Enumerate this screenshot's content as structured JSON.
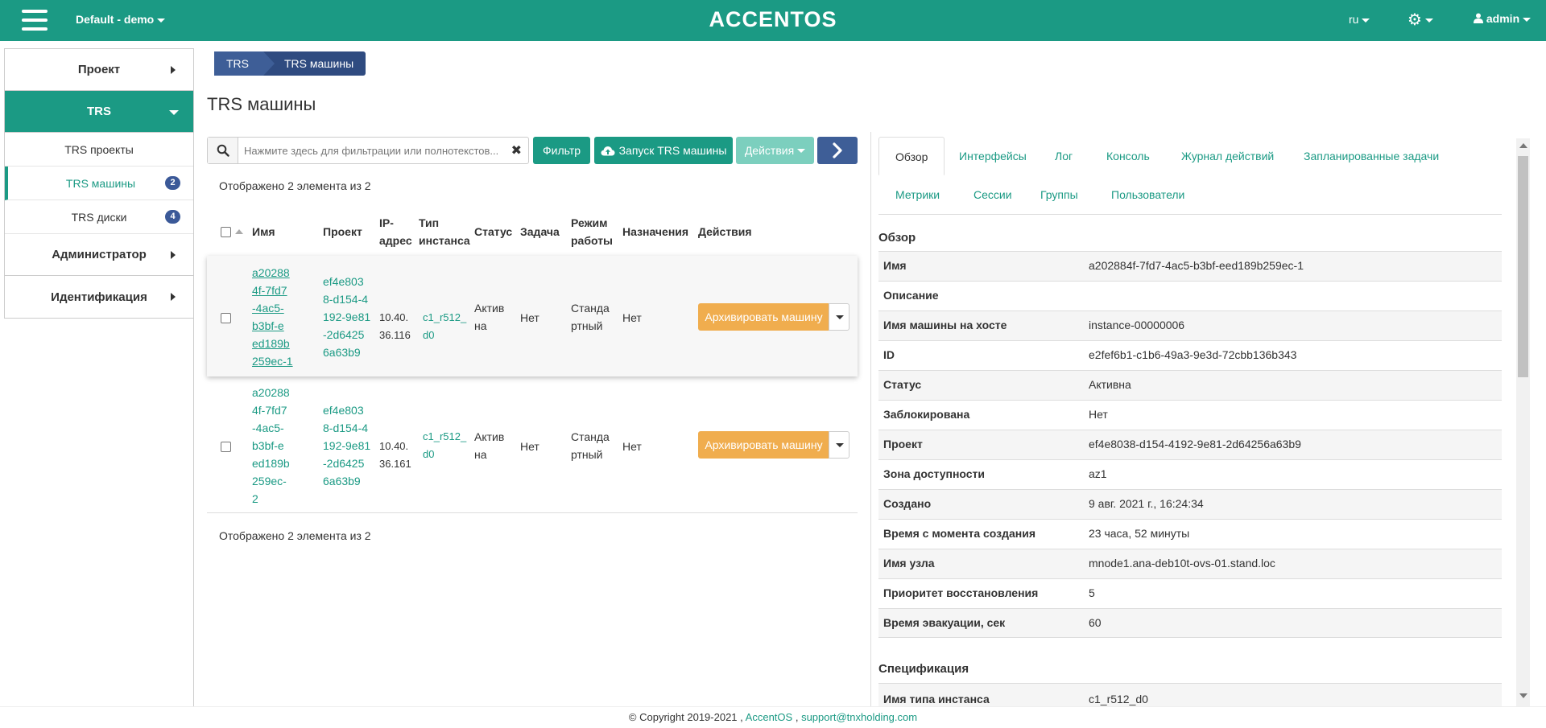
{
  "topbar": {
    "project_select": "Default - demo",
    "logo": "ACCENTOS",
    "lang": "ru",
    "user": "admin"
  },
  "sidebar": {
    "project": "Проект",
    "trs": "TRS",
    "items": [
      {
        "label": "TRS проекты",
        "badge": ""
      },
      {
        "label": "TRS машины",
        "badge": "2"
      },
      {
        "label": "TRS диски",
        "badge": "4"
      }
    ],
    "admin": "Администратор",
    "identity": "Идентификация"
  },
  "breadcrumb": {
    "root": "TRS",
    "current": "TRS машины"
  },
  "page_title": "TRS машины",
  "toolbar": {
    "search_placeholder": "Нажмите здесь для фильтрации или полнотекстов...",
    "filter": "Фильтр",
    "launch": "Запуск TRS машины",
    "actions": "Действия"
  },
  "count_text": "Отображено 2 элемента из 2",
  "table": {
    "headers": {
      "name": "Имя",
      "project": "Проект",
      "ip": [
        "IP-",
        "адрес"
      ],
      "type": [
        "Тип",
        "инстанса"
      ],
      "status": "Статус",
      "task": "Задача",
      "mode": [
        "Режим",
        "работы"
      ],
      "assign": "Назначения",
      "actions": "Действия"
    },
    "rows": [
      {
        "name": [
          "a20288",
          "4f-7fd7",
          "-4ac5-",
          "b3bf-e",
          "ed189b",
          "259ec-1"
        ],
        "project": [
          "ef4e803",
          "8-d154-4",
          "192-9e81",
          "-2d6425",
          "6a63b9"
        ],
        "ip": [
          "10.40.",
          "36.116"
        ],
        "type": [
          "c1_r512_",
          "d0"
        ],
        "status": [
          "Актив",
          "на"
        ],
        "task": "Нет",
        "mode": [
          "Станда",
          "ртный"
        ],
        "assign": "Нет",
        "action": "Архивировать машину"
      },
      {
        "name": [
          "a20288",
          "4f-7fd7",
          "-4ac5-",
          "b3bf-e",
          "ed189b",
          "259ec-",
          "2"
        ],
        "project": [
          "ef4e803",
          "8-d154-4",
          "192-9e81",
          "-2d6425",
          "6a63b9"
        ],
        "ip": [
          "10.40.",
          "36.161"
        ],
        "type": [
          "c1_r512_",
          "d0"
        ],
        "status": [
          "Актив",
          "на"
        ],
        "task": "Нет",
        "mode": [
          "Станда",
          "ртный"
        ],
        "assign": "Нет",
        "action": "Архивировать машину"
      }
    ]
  },
  "detail": {
    "tabs": [
      "Обзор",
      "Интерфейсы",
      "Лог",
      "Консоль",
      "Журнал действий",
      "Запланированные задачи",
      "Метрики",
      "Сессии",
      "Группы",
      "Пользователи"
    ],
    "overview_title": "Обзор",
    "fields": [
      {
        "k": "Имя",
        "v": "a202884f-7fd7-4ac5-b3bf-eed189b259ec-1"
      },
      {
        "k": "Описание",
        "v": ""
      },
      {
        "k": "Имя машины на хосте",
        "v": "instance-00000006"
      },
      {
        "k": "ID",
        "v": "e2fef6b1-c1b6-49a3-9e3d-72cbb136b343"
      },
      {
        "k": "Статус",
        "v": "Активна"
      },
      {
        "k": "Заблокирована",
        "v": "Нет"
      },
      {
        "k": "Проект",
        "v": "ef4e8038-d154-4192-9e81-2d64256a63b9"
      },
      {
        "k": "Зона доступности",
        "v": "az1"
      },
      {
        "k": "Создано",
        "v": "9 авг. 2021 г., 16:24:34"
      },
      {
        "k": "Время с момента создания",
        "v": "23 часа, 52 минуты"
      },
      {
        "k": "Имя узла",
        "v": "mnode1.ana-deb10t-ovs-01.stand.loc"
      },
      {
        "k": "Приоритет восстановления",
        "v": "5"
      },
      {
        "k": "Время эвакуации, сек",
        "v": "60"
      }
    ],
    "spec_title": "Спецификация",
    "spec_fields": [
      {
        "k": "Имя типа инстанса",
        "v": "c1_r512_d0"
      }
    ]
  },
  "footer": {
    "copyright": "© Copyright 2019-2021 ,",
    "brand": "AccentOS",
    "sep": ",",
    "email": "support@tnxholding.com"
  }
}
